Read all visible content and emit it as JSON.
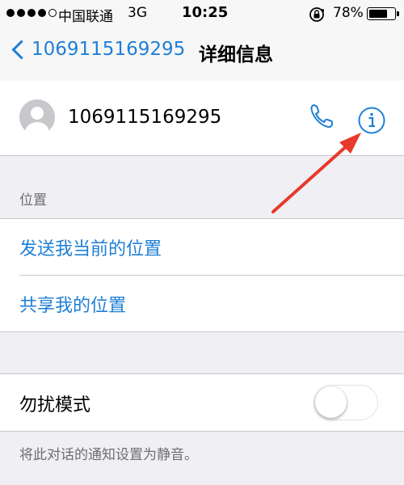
{
  "status_bar": {
    "carrier": "中国联通",
    "network": "3G",
    "time": "10:25",
    "battery": "78%",
    "battery_level": 0.78,
    "signal_bars_filled": 4,
    "signal_bars_total": 5
  },
  "nav": {
    "back_label": "1069115169295",
    "title": "详细信息"
  },
  "contact": {
    "number": "1069115169295"
  },
  "location_section": {
    "header": "位置",
    "items": [
      {
        "label": "发送我当前的位置"
      },
      {
        "label": "共享我的位置"
      }
    ]
  },
  "dnd": {
    "label": "勿扰模式",
    "enabled": false,
    "footer": "将此对话的通知设置为静音。"
  },
  "colors": {
    "accent": "#1f7fd6",
    "annotation_arrow": "#e8392b",
    "background": "#efeff4"
  }
}
